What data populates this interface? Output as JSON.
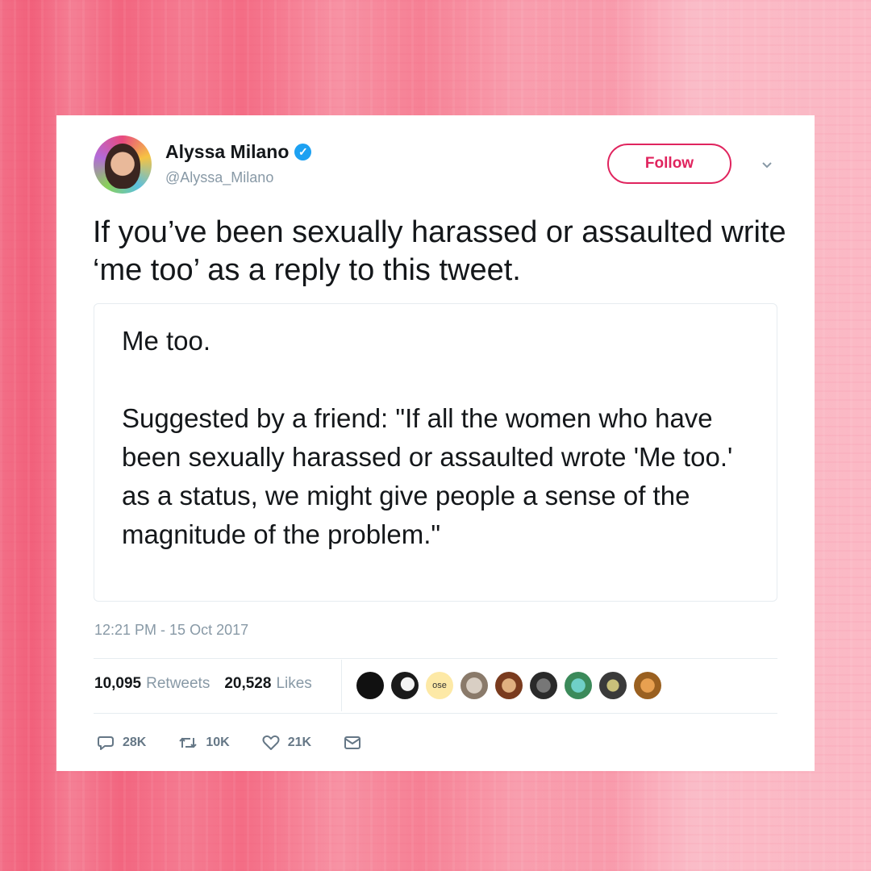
{
  "tweet": {
    "author_name": "Alyssa Milano",
    "handle": "@Alyssa_Milano",
    "follow_label": "Follow",
    "text": "If you’ve been sexually harassed or assaulted write ‘me too’ as a reply to this tweet.",
    "quoted_line1": "Me too.",
    "quoted_line2": "Suggested by a friend: \"If all the women who have been sexually harassed or assaulted wrote 'Me too.' as a status, we might give people a sense of the magnitude of the problem.\"",
    "timestamp": "12:21 PM - 15 Oct 2017"
  },
  "stats": {
    "retweets_count": "10,095",
    "retweets_label": "Retweets",
    "likes_count": "20,528",
    "likes_label": "Likes",
    "liker_avatar_text": "ose"
  },
  "actions": {
    "reply_count": "28K",
    "retweet_count": "10K",
    "like_count": "21K"
  },
  "colors": {
    "accent": "#e0245e",
    "verified": "#1da1f2",
    "muted": "#8899a6",
    "background_pink": "#f46e86"
  },
  "icons": [
    "verified-badge-icon",
    "chevron-down-icon",
    "reply-icon",
    "retweet-icon",
    "like-icon",
    "message-icon"
  ]
}
